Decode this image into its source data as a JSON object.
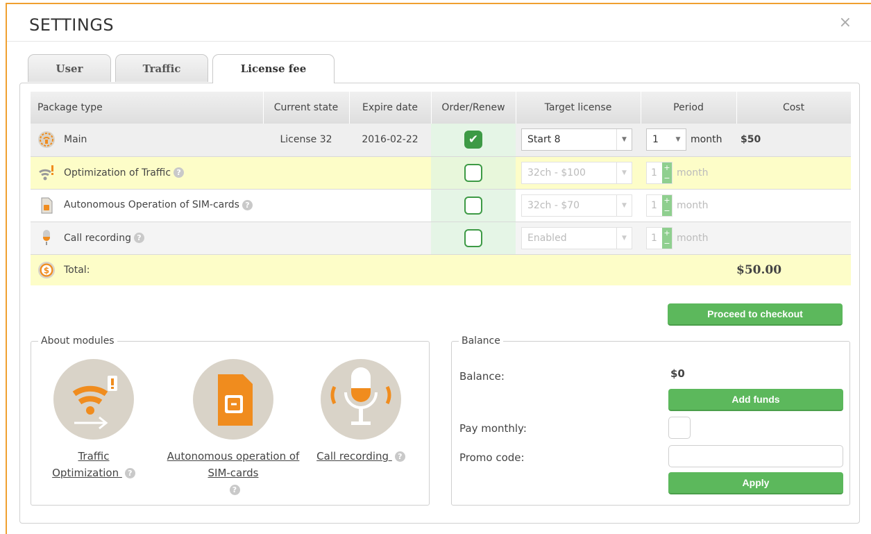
{
  "dialog": {
    "title": "SETTINGS",
    "close_glyph": "×"
  },
  "tabs": [
    {
      "label": "User",
      "active": false
    },
    {
      "label": "Traffic",
      "active": false
    },
    {
      "label": "License fee",
      "active": true
    }
  ],
  "table": {
    "headers": [
      "Package type",
      "Current state",
      "Expire date",
      "Order/Renew",
      "Target license",
      "Period",
      "Cost"
    ],
    "rows": [
      {
        "icon": "router-icon",
        "name": "Main",
        "current_state": "License 32",
        "expire_date": "2016-02-22",
        "ordered": true,
        "target": "Start 8",
        "period": "1",
        "period_unit": "month",
        "cost": "$50"
      },
      {
        "icon": "wifi-alert-icon",
        "name": "Optimization of Traffic",
        "help": "?",
        "ordered": false,
        "target": "32ch - $100",
        "period": "1",
        "period_unit": "month"
      },
      {
        "icon": "sim-card-icon",
        "name": "Autonomous Operation of SIM-cards",
        "help": "?",
        "ordered": false,
        "target": "32ch - $70",
        "period": "1",
        "period_unit": "month"
      },
      {
        "icon": "microphone-icon",
        "name": "Call recording",
        "help": "?",
        "ordered": false,
        "target": "Enabled",
        "period": "1",
        "period_unit": "month"
      }
    ],
    "total_label": "Total:",
    "total_value": "$50.00"
  },
  "checkout_button": "Proceed to checkout",
  "about": {
    "legend": "About modules",
    "modules": [
      {
        "label": "Traffic Optimization",
        "icon": "wifi-alert-icon"
      },
      {
        "label": "Autonomous operation of SIM-cards",
        "icon": "sim-card-icon"
      },
      {
        "label": "Call recording",
        "icon": "microphone-icon"
      }
    ]
  },
  "balance": {
    "legend": "Balance",
    "balance_label": "Balance:",
    "balance_value": "$0",
    "add_funds": "Add funds",
    "pay_monthly_label": "Pay monthly:",
    "promo_label": "Promo code:",
    "promo_value": "",
    "apply": "Apply"
  },
  "colors": {
    "accent_green": "#5cb85c",
    "highlight_yellow": "#fdfdc8",
    "window_border": "#f0a030",
    "icon_orange": "#f08c1e"
  }
}
